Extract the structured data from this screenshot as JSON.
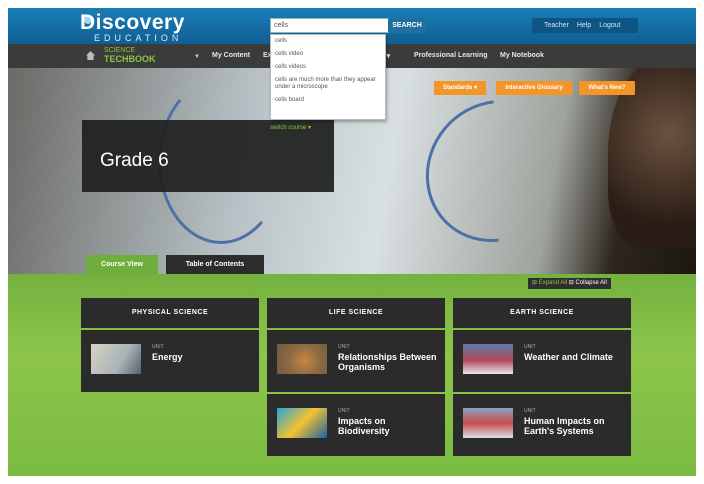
{
  "header": {
    "brand": "Discovery",
    "brand_sub": "EDUCATION",
    "search_value": "cells",
    "search_button": "SEARCH",
    "user_links": [
      "Teacher",
      "Help",
      "Logout"
    ]
  },
  "nav": {
    "product_small": "SCIENCE",
    "product_big": "TECHBOOK",
    "items": [
      "My Content",
      "Professional Learning",
      "My Notebook"
    ],
    "partial_item_1": "Ex",
    "partial_item_2": "er"
  },
  "hero": {
    "buttons": [
      "Standards",
      "Interactive Glossary",
      "What's New?"
    ],
    "switch_label": "switch course",
    "grade_title": "Grade 6"
  },
  "tabs": [
    "Course View",
    "Table of Contents"
  ],
  "controls": {
    "expand_all": "Expand All",
    "collapse_all": "Collapse All"
  },
  "columns": [
    {
      "heading": "PHYSICAL SCIENCE",
      "units": [
        {
          "label": "UNIT",
          "title": "Energy"
        }
      ]
    },
    {
      "heading": "LIFE SCIENCE",
      "units": [
        {
          "label": "UNIT",
          "title": "Relationships Between Organisms"
        },
        {
          "label": "UNIT",
          "title": "Impacts on Biodiversity"
        }
      ]
    },
    {
      "heading": "EARTH SCIENCE",
      "units": [
        {
          "label": "UNIT",
          "title": "Weather and Climate"
        },
        {
          "label": "UNIT",
          "title": "Human Impacts on Earth's Systems"
        }
      ]
    }
  ],
  "search_suggestions": [
    "cells",
    "cells video",
    "cells videos",
    "cells are much more than they appear under a microscope",
    "cells board"
  ],
  "colors": {
    "accent_green": "#8cc63f",
    "accent_orange": "#f3962a",
    "top_blue": "#1b7db6"
  }
}
